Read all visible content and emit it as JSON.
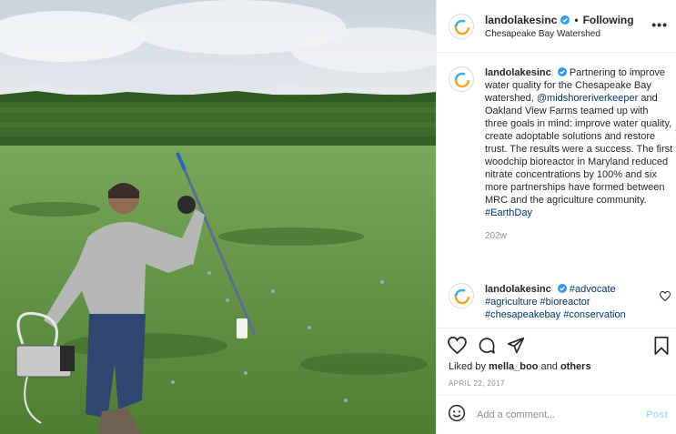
{
  "post": {
    "username": "landolakesinc",
    "follow_separator": "•",
    "follow_label": "Following",
    "location": "Chesapeake Bay Watershed",
    "more_label": "•••"
  },
  "caption": {
    "username": "landolakesinc",
    "text_part1": "Partnering to improve water quality for the Chesapeake Bay watershed,",
    "mention": "@midshoreriverkeeper",
    "text_part2": "and Oakland View Farms teamed up with three goals in mind: improve water quality, create adoptable solutions and restore trust. The results were a success. The first woodchip bioreactor in Maryland reduced nitrate concentrations by 100% and six more partnerships have formed between MRC and the agriculture community.",
    "hashtag": "#EarthDay",
    "age": "202w"
  },
  "comment2": {
    "username": "landolakesinc",
    "tags": [
      "#advocate",
      "#agriculture",
      "#bioreactor",
      "#chesapeakebay",
      "#conservation"
    ]
  },
  "actions": {
    "liked_by_prefix": "Liked by",
    "liked_by_user": "mella_boo",
    "liked_by_and": "and",
    "liked_by_others": "others",
    "date": "APRIL 22, 2017"
  },
  "add_comment": {
    "placeholder": "Add a comment...",
    "post_label": "Post"
  },
  "colors": {
    "link": "#00376b",
    "verified": "#3897f0",
    "post_disabled": "#b2dffc"
  },
  "icons": [
    "verified-badge-icon",
    "more-options-icon",
    "heart-icon",
    "comment-icon",
    "share-icon",
    "bookmark-icon",
    "emoji-icon",
    "like-comment-icon"
  ]
}
